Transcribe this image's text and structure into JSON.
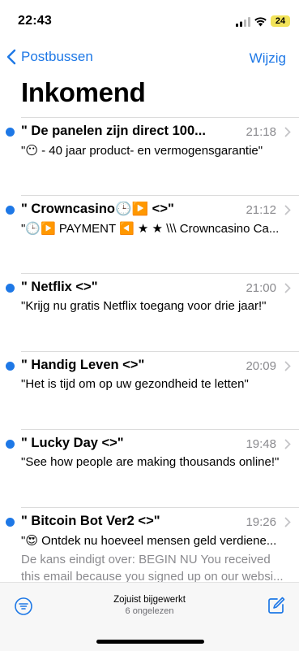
{
  "status_bar": {
    "time": "22:43",
    "battery": "24"
  },
  "nav": {
    "back_label": "Postbussen",
    "edit_label": "Wijzig"
  },
  "title": "Inkomend",
  "messages": [
    {
      "sender": "\" De panelen zijn direct 100...",
      "time": "21:18",
      "subject": "\"😶 - 40 jaar product- en vermogensgarantie\"",
      "preview": ""
    },
    {
      "sender": "\" Crowncasino🕒▶️  <>\"",
      "time": "21:12",
      "subject": "\"🕒▶️ PAYMENT ◀️ ★ ★ \\\\\\ Crowncasino  Ca...",
      "preview": ""
    },
    {
      "sender": "\" Netflix  <>\"",
      "time": "21:00",
      "subject": "\"Krijg nu gratis Netflix toegang voor drie jaar!\"",
      "preview": ""
    },
    {
      "sender": "\" Handig Leven  <>\"",
      "time": "20:09",
      "subject": "\"Het is tijd om op uw gezondheid te letten\"",
      "preview": ""
    },
    {
      "sender": "\" Lucky Day  <>\"",
      "time": "19:48",
      "subject": "\"See how people are making thousands online!\"",
      "preview": ""
    },
    {
      "sender": "\" Bitcoin Bot Ver2  <>\"",
      "time": "19:26",
      "subject": "\"😍  Ontdek nu hoeveel mensen geld verdiene...",
      "preview": "De kans eindigt over: BEGIN NU You received this email because you signed up on our websi..."
    }
  ],
  "toolbar": {
    "status_main": "Zojuist bijgewerkt",
    "status_sub": "6 ongelezen"
  },
  "colors": {
    "accent": "#1e78e6",
    "unread_dot": "#1e78e6",
    "battery": "#f2e35a"
  },
  "icons": [
    "signal-icon",
    "wifi-icon",
    "battery-icon",
    "chevron-left-icon",
    "chevron-right-icon",
    "filter-icon",
    "compose-icon"
  ]
}
